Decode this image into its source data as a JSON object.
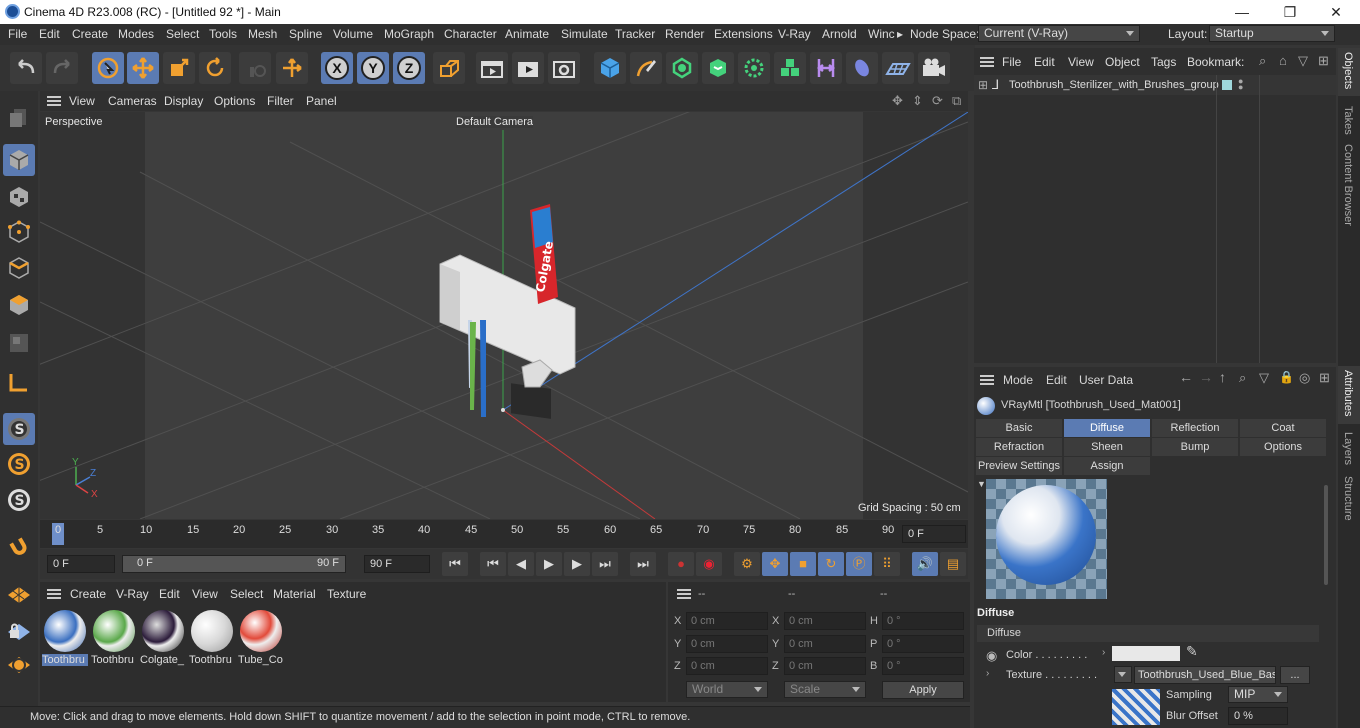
{
  "window": {
    "title": "Cinema 4D R23.008 (RC) - [Untitled 92 *] - Main",
    "minimize": "—",
    "maximize": "❐",
    "close": "✕"
  },
  "menu": {
    "items": [
      "File",
      "Edit",
      "Create",
      "Modes",
      "Select",
      "Tools",
      "Mesh",
      "Spline",
      "Volume",
      "MoGraph",
      "Character",
      "Animate",
      "Simulate",
      "Tracker",
      "Render",
      "Extensions",
      "V-Ray",
      "Arnold",
      "Winc"
    ],
    "more": "▸",
    "node_space_label": "Node Space:",
    "node_space_value": "Current (V-Ray)",
    "layout_label": "Layout:",
    "layout_value": "Startup"
  },
  "viewport": {
    "menu": [
      "View",
      "Cameras",
      "Display",
      "Options",
      "Filter",
      "Panel"
    ],
    "label": "Perspective",
    "camera": "Default Camera",
    "grid_spacing": "Grid Spacing : 50 cm",
    "axis_y": "Y",
    "axis_z": "Z",
    "axis_x": "X"
  },
  "product": {
    "brand": "Colgate"
  },
  "timeline": {
    "ticks": [
      "0",
      "5",
      "10",
      "15",
      "20",
      "25",
      "30",
      "35",
      "40",
      "45",
      "50",
      "55",
      "60",
      "65",
      "70",
      "75",
      "80",
      "85",
      "90"
    ],
    "current_frame": "0 F"
  },
  "transport": {
    "start": "0 F",
    "range_start": "0 F",
    "range_end": "90 F",
    "end": "90 F"
  },
  "materials": {
    "menu": [
      "Create",
      "V-Ray",
      "Edit",
      "View",
      "Select",
      "Material",
      "Texture"
    ],
    "items": [
      {
        "label": "Toothbru"
      },
      {
        "label": "Toothbru"
      },
      {
        "label": "Colgate_"
      },
      {
        "label": "Toothbru"
      },
      {
        "label": "Tube_Co"
      }
    ]
  },
  "coords": {
    "header": [
      "--",
      "--",
      "--"
    ],
    "rows": [
      {
        "a": "X",
        "av": "0 cm",
        "b": "X",
        "bv": "0 cm",
        "c": "H",
        "cv": "0 °"
      },
      {
        "a": "Y",
        "av": "0 cm",
        "b": "Y",
        "bv": "0 cm",
        "c": "P",
        "cv": "0 °"
      },
      {
        "a": "Z",
        "av": "0 cm",
        "b": "Z",
        "bv": "0 cm",
        "c": "B",
        "cv": "0 °"
      }
    ],
    "world": "World",
    "scale": "Scale",
    "apply": "Apply"
  },
  "status": "Move: Click and drag to move elements. Hold down SHIFT to quantize movement / add to the selection in point mode, CTRL to remove.",
  "objects": {
    "menu": [
      "File",
      "Edit",
      "View",
      "Object",
      "Tags",
      "Bookmark:"
    ],
    "item": "Toothbrush_Sterilizer_with_Brushes_group"
  },
  "attributes": {
    "menu": [
      "Mode",
      "Edit",
      "User Data"
    ],
    "material_name": "VRayMtl [Toothbrush_Used_Mat001]",
    "tabs": [
      "Basic",
      "Diffuse",
      "Reflection",
      "Coat",
      "Refraction",
      "Sheen",
      "Bump",
      "Options",
      "Preview Settings",
      "Assign"
    ],
    "section": "Diffuse",
    "subsection": "Diffuse",
    "color_label": "Color . . . . . . . . .",
    "texture_label": "Texture . . . . . . . . .",
    "texture_value": "Toothbrush_Used_Blue_Base",
    "more_button": "...",
    "sampling_label": "Sampling",
    "sampling_value": "MIP",
    "blur_label": "Blur Offset",
    "blur_value": "0 %"
  },
  "side_tabs": [
    "Objects",
    "Takes",
    "Content Browser",
    "Attributes",
    "Layers",
    "Structure"
  ]
}
